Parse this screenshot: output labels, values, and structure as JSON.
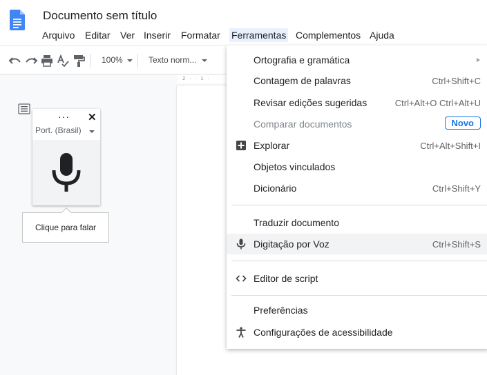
{
  "header": {
    "title": "Documento sem título",
    "menus": [
      {
        "label": "Arquivo"
      },
      {
        "label": "Editar"
      },
      {
        "label": "Ver"
      },
      {
        "label": "Inserir"
      },
      {
        "label": "Formatar"
      },
      {
        "label": "Ferramentas",
        "active": true
      },
      {
        "label": "Complementos"
      },
      {
        "label": "Ajuda"
      }
    ]
  },
  "toolbar": {
    "zoom": "100%",
    "style": "Texto norm...",
    "icons": [
      "undo-icon",
      "redo-icon",
      "print-icon",
      "spellcheck-icon",
      "paint-format-icon"
    ]
  },
  "ruler": {
    "text": "· 2 · · 1 ·"
  },
  "voice": {
    "dots": "···",
    "close": "✕",
    "language": "Port. (Brasil)",
    "tooltip": "Clique para falar"
  },
  "tools_menu": {
    "items": [
      {
        "label": "Ortografia e gramática",
        "submenu": true
      },
      {
        "label": "Contagem de palavras",
        "shortcut": "Ctrl+Shift+C"
      },
      {
        "label": "Revisar edições sugeridas",
        "shortcut": "Ctrl+Alt+O Ctrl+Alt+U"
      },
      {
        "label": "Comparar documentos",
        "badge": "Novo",
        "disabled": true
      },
      {
        "label": "Explorar",
        "shortcut": "Ctrl+Alt+Shift+I",
        "icon": "explore-icon"
      },
      {
        "label": "Objetos vinculados"
      },
      {
        "label": "Dicionário",
        "shortcut": "Ctrl+Shift+Y"
      },
      {
        "label": "Traduzir documento"
      },
      {
        "label": "Digitação por Voz",
        "shortcut": "Ctrl+Shift+S",
        "icon": "microphone-icon",
        "highlighted": true
      },
      {
        "label": "Editor de script",
        "icon": "code-icon"
      },
      {
        "label": "Preferências"
      },
      {
        "label": "Configurações de acessibilidade",
        "icon": "accessibility-icon"
      }
    ]
  },
  "colors": {
    "accent": "#1a73e8",
    "docs_blue": "#4285f4",
    "menu_active": "#e8f0fe",
    "highlight": "#f1f3f4"
  }
}
